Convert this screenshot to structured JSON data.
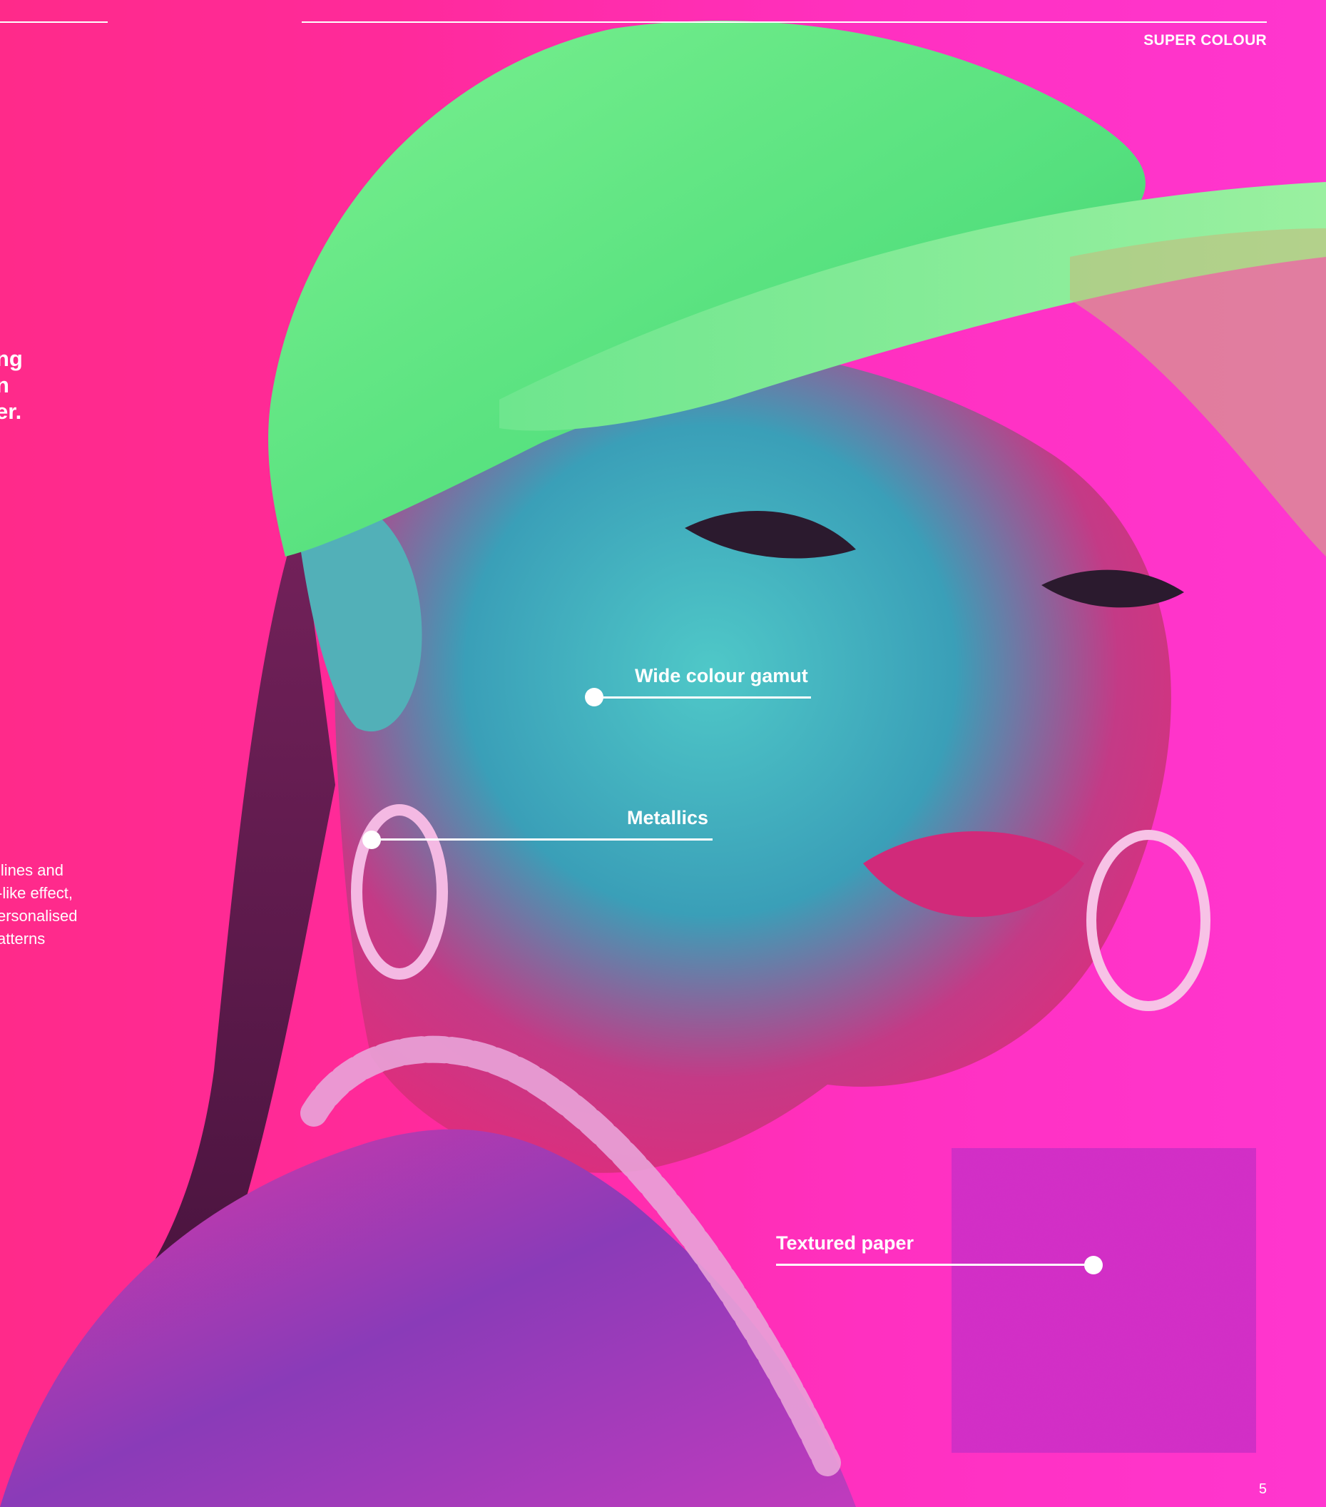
{
  "header": {
    "running_head": "SUPER COLOUR"
  },
  "facing_page_clip": {
    "heading_lines": [
      "ng",
      "n",
      "er."
    ],
    "body_lines": [
      "llines and",
      "-like effect,",
      "ersonalised",
      "atterns"
    ]
  },
  "callouts": {
    "wide_gamut": "Wide colour gamut",
    "metallics": "Metallics",
    "textured_paper": "Textured paper"
  },
  "footer": {
    "page_number": "5"
  },
  "colors": {
    "background": "#ff2a9b",
    "cap": "#5ee88a",
    "swatch": "#d52bc6",
    "text": "#ffffff"
  }
}
